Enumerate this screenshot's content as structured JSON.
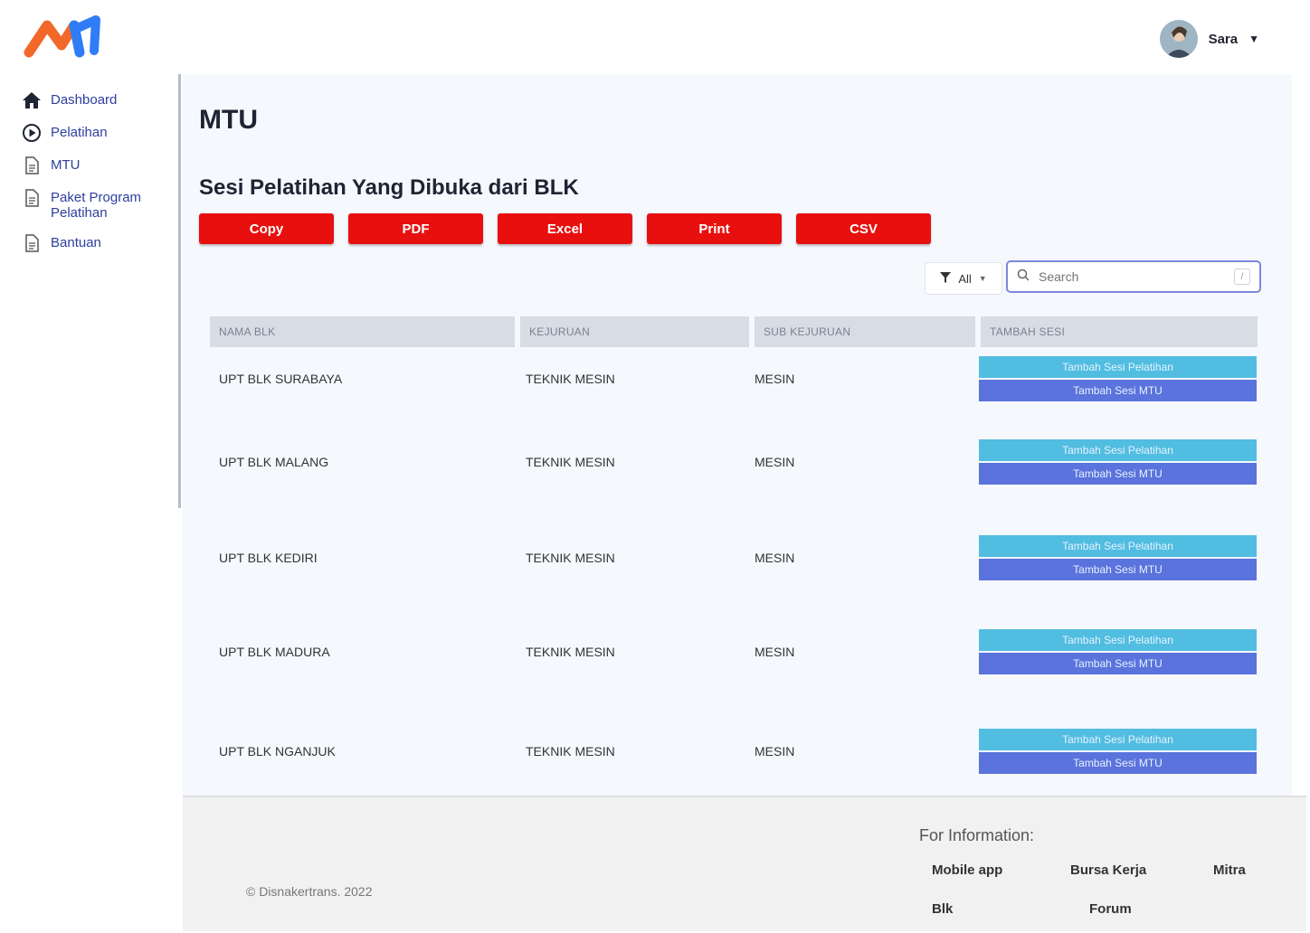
{
  "header": {
    "user_name": "Sara"
  },
  "sidebar": {
    "items": [
      {
        "label": "Dashboard",
        "icon": "home-icon"
      },
      {
        "label": "Pelatihan",
        "icon": "play-circle-icon"
      },
      {
        "label": "MTU",
        "icon": "document-icon"
      },
      {
        "label": "Paket Program Pelatihan",
        "icon": "document-icon"
      },
      {
        "label": "Bantuan",
        "icon": "document-icon"
      }
    ]
  },
  "main": {
    "page_title": "MTU",
    "section_title": "Sesi Pelatihan Yang Dibuka dari BLK",
    "export_buttons": [
      "Copy",
      "PDF",
      "Excel",
      "Print",
      "CSV"
    ],
    "filter_label": "All",
    "search_placeholder": "Search",
    "search_shortcut": "/",
    "table": {
      "columns": [
        "NAMA BLK",
        "KEJURUAN",
        "SUB KEJURUAN",
        "TAMBAH SESI"
      ],
      "rows": [
        {
          "nama_blk": "UPT BLK SURABAYA",
          "kejuruan": "TEKNIK MESIN",
          "sub_kejuruan": "MESIN"
        },
        {
          "nama_blk": "UPT BLK MALANG",
          "kejuruan": "TEKNIK MESIN",
          "sub_kejuruan": "MESIN"
        },
        {
          "nama_blk": "UPT BLK KEDIRI",
          "kejuruan": "TEKNIK MESIN",
          "sub_kejuruan": "MESIN"
        },
        {
          "nama_blk": "UPT BLK MADURA",
          "kejuruan": "TEKNIK MESIN",
          "sub_kejuruan": "MESIN"
        },
        {
          "nama_blk": "UPT BLK NGANJUK",
          "kejuruan": "TEKNIK MESIN",
          "sub_kejuruan": "MESIN"
        }
      ],
      "action_pelatihan": "Tambah Sesi Pelatihan",
      "action_mtu": "Tambah Sesi MTU"
    }
  },
  "footer": {
    "copyright": "© Disnakertrans. 2022",
    "info_title": "For Information:",
    "links": [
      "Mobile app",
      "Bursa Kerja",
      "Mitra",
      "Blk",
      "Forum"
    ]
  },
  "colors": {
    "brand_orange": "#f2672a",
    "brand_blue": "#2f7df6",
    "export_red": "#e8100f",
    "action_cyan": "#51bde0",
    "action_indigo": "#5b73dc",
    "nav_text": "#2d3f9e"
  }
}
